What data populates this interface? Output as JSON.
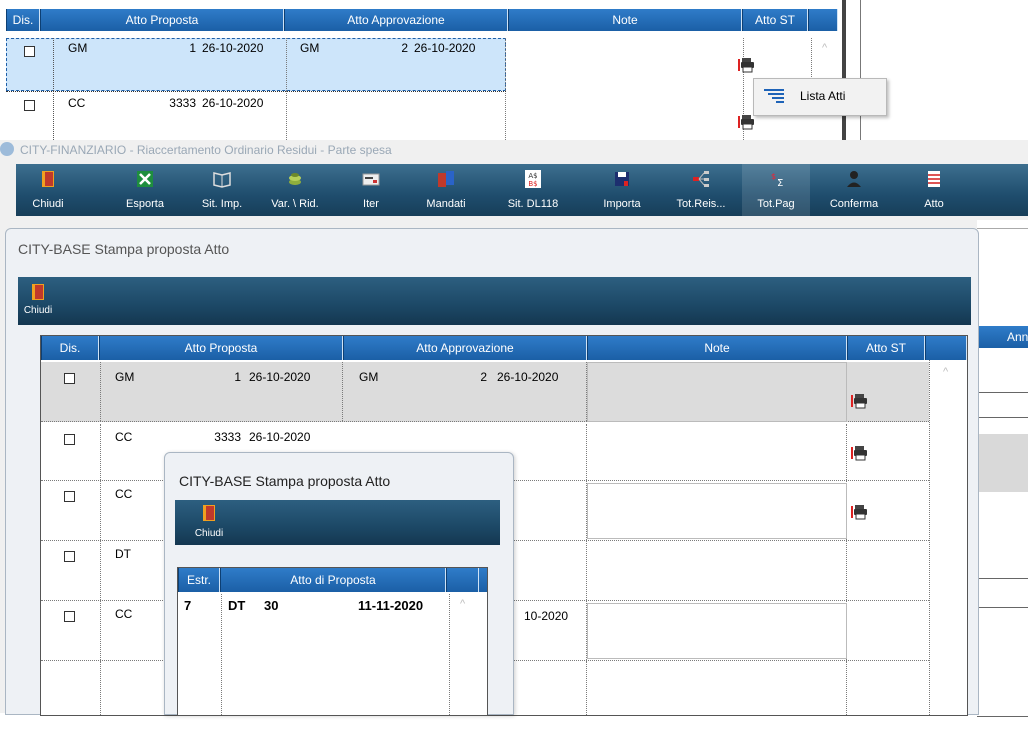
{
  "grid_columns": {
    "dis": "Dis.",
    "atto_proposta": "Atto Proposta",
    "atto_approvazione": "Atto Approvazione",
    "note": "Note",
    "atto_st": "Atto ST"
  },
  "top_rows": [
    {
      "tipo": "GM",
      "numero": "1",
      "data": "26-10-2020",
      "appr_tipo": "GM",
      "appr_numero": "2",
      "appr_data": "26-10-2020"
    },
    {
      "tipo": "CC",
      "numero": "3333",
      "data": "26-10-2020",
      "appr_tipo": "",
      "appr_numero": "",
      "appr_data": ""
    }
  ],
  "context_menu": {
    "item": "Lista Atti"
  },
  "main_window": {
    "title": "CITY-FINANZIARIO - Riaccertamento Ordinario Residui - Parte spesa",
    "toolbar": [
      {
        "label": "Chiudi",
        "icon": "door-icon"
      },
      {
        "label": "Esporta",
        "icon": "excel-icon"
      },
      {
        "label": "Sit. Imp.",
        "icon": "book-icon"
      },
      {
        "label": "Var. \\ Rid.",
        "icon": "coins-icon"
      },
      {
        "label": "Iter",
        "icon": "card-icon"
      },
      {
        "label": "Mandati",
        "icon": "binder-icon"
      },
      {
        "label": "Sit. DL118",
        "icon": "currency-icon"
      },
      {
        "label": "Importa",
        "icon": "disk-icon"
      },
      {
        "label": "Tot.Reis...",
        "icon": "flow-icon"
      },
      {
        "label": "Tot.Pag",
        "icon": "sum-icon"
      },
      {
        "label": "Conferma",
        "icon": "person-icon"
      },
      {
        "label": "Atto",
        "icon": "document-icon"
      }
    ],
    "right_header": "Ann"
  },
  "dialog1": {
    "title": "CITY-BASE Stampa proposta Atto",
    "close_label": "Chiudi",
    "rows": [
      {
        "tipo": "GM",
        "numero": "1",
        "data": "26-10-2020",
        "appr_tipo": "GM",
        "appr_numero": "2",
        "appr_data": "26-10-2020",
        "printer": true
      },
      {
        "tipo": "CC",
        "numero": "3333",
        "data": "26-10-2020",
        "appr_tipo": "",
        "appr_numero": "",
        "appr_data": "",
        "printer": true
      },
      {
        "tipo": "CC",
        "numero": "",
        "data": "",
        "appr_tipo": "",
        "appr_numero": "",
        "appr_data": "",
        "printer": true
      },
      {
        "tipo": "DT",
        "numero": "",
        "data": "",
        "appr_tipo": "",
        "appr_numero": "",
        "appr_data": "",
        "printer": false
      },
      {
        "tipo": "CC",
        "numero": "",
        "data": "",
        "appr_tipo": "",
        "appr_numero": "",
        "appr_data": "10-2020",
        "printer": false
      }
    ]
  },
  "dialog2": {
    "title": "CITY-BASE Stampa proposta Atto",
    "close_label": "Chiudi",
    "columns": {
      "estr": "Estr.",
      "atto_di_proposta": "Atto di Proposta"
    },
    "rows": [
      {
        "estr": "7",
        "tipo": "DT",
        "numero": "30",
        "data": "11-11-2020"
      }
    ]
  },
  "colors": {
    "header_blue": "#1b5fa6",
    "toolbar_teal": "#1f4d6d",
    "selection_blue": "#cde5fa",
    "selected_row_gray": "#dcdcdc"
  }
}
